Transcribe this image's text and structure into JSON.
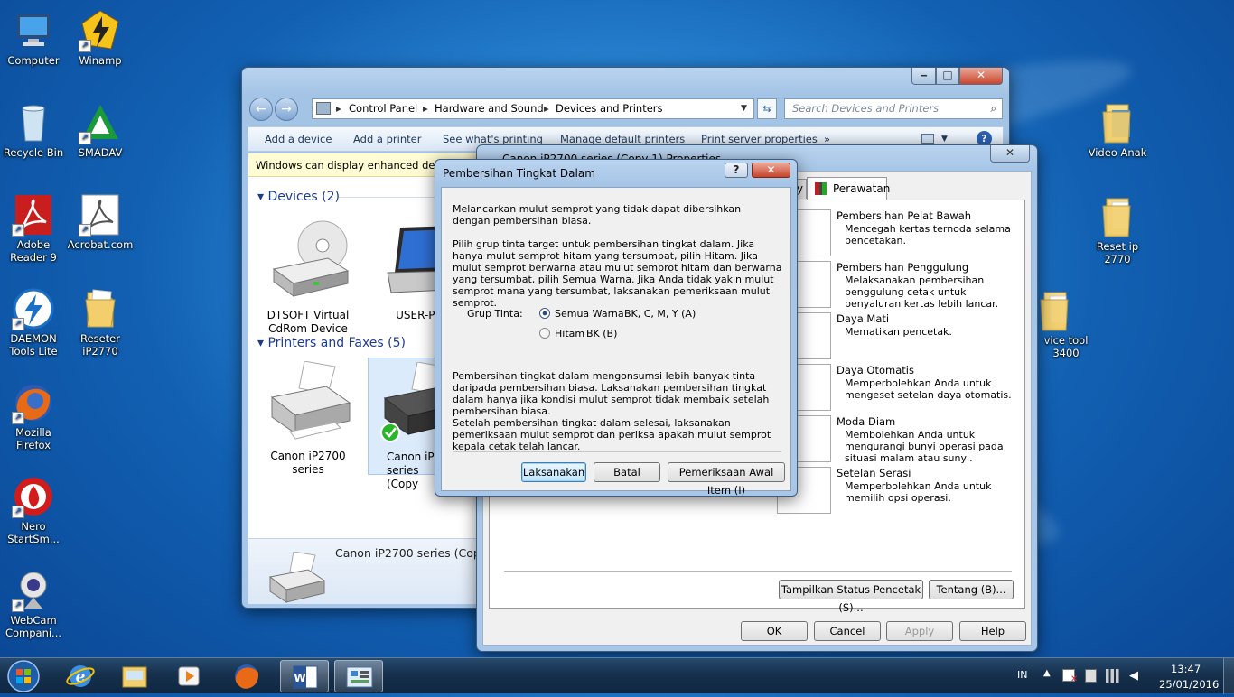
{
  "desktop_icons": [
    {
      "label": "Computer"
    },
    {
      "label": "Winamp"
    },
    {
      "label": "Recycle Bin"
    },
    {
      "label": "SMADAV"
    },
    {
      "label": "Adobe Reader 9"
    },
    {
      "label": "Acrobat.com"
    },
    {
      "label": "DAEMON Tools Lite"
    },
    {
      "label": "Reseter iP2770"
    },
    {
      "label": "Mozilla Firefox"
    },
    {
      "label": "Nero StartSm..."
    },
    {
      "label": "WebCam Compani..."
    },
    {
      "label": "Video Anak"
    },
    {
      "label": "Reset ip 2770"
    },
    {
      "label": "vice tool 3400"
    }
  ],
  "explorer": {
    "breadcrumb": [
      "Control Panel",
      "Hardware and Sound",
      "Devices and Printers"
    ],
    "search_placeholder": "Search Devices and Printers",
    "toolbar": [
      "Add a device",
      "Add a printer",
      "See what's printing",
      "Manage default printers",
      "Print server properties",
      "»"
    ],
    "infobar": "Windows can display enhanced device",
    "devices_header": "Devices (2)",
    "devices": [
      "DTSOFT Virtual CdRom Device",
      "USER-PC"
    ],
    "printers_header": "Printers and Faxes (5)",
    "printers": [
      "Canon iP2700 series",
      "Canon iP27 series (Copy"
    ],
    "details_name": "Canon iP2700 series (Copy"
  },
  "properties": {
    "title": "Canon iP2700 series (Copy 1) Properties",
    "tab_partial": "y",
    "tab_active": "Perawatan",
    "items": [
      {
        "title": "Pembersihan Pelat Bawah",
        "desc": "Mencegah kertas ternoda selama pencetakan."
      },
      {
        "title": "Pembersihan Penggulung",
        "desc": "Melaksanakan pembersihan penggulung cetak untuk penyaluran kertas lebih lancar."
      },
      {
        "title": "Daya Mati",
        "desc": "Mematikan pencetak."
      },
      {
        "title": "Daya Otomatis",
        "desc": "Memperbolehkan Anda untuk mengeset setelan daya otomatis."
      },
      {
        "title": "Moda Diam",
        "desc": "Membolehkan Anda untuk mengurangi bunyi operasi pada situasi malam atau sunyi."
      },
      {
        "title": "Setelan Serasi",
        "desc": "Memperbolehkan Anda untuk memilih opsi operasi."
      }
    ],
    "status_button": "Tampilkan Status Pencetak (S)...",
    "about_button": "Tentang (B)...",
    "ok": "OK",
    "cancel": "Cancel",
    "apply": "Apply",
    "help": "Help"
  },
  "dialog": {
    "title": "Pembersihan Tingkat Dalam",
    "para1": "Melancarkan mulut semprot yang tidak dapat dibersihkan dengan pembersihan biasa.",
    "para2": "Pilih grup tinta target untuk pembersihan tingkat dalam. Jika hanya mulut semprot hitam yang tersumbat, pilih Hitam. Jika mulut semprot berwarna atau mulut semprot hitam dan berwarna yang tersumbat, pilih Semua Warna. Jika Anda tidak yakin mulut semprot mana yang tersumbat, laksanakan pemeriksaan mulut semprot.",
    "group_label": "Grup Tinta:",
    "option1_name": "Semua Warna",
    "option1_inks": "BK, C, M, Y (A)",
    "option2_name": "Hitam",
    "option2_inks": "BK (B)",
    "selected_option": "Semua Warna",
    "para3": "Pembersihan tingkat dalam mengonsumsi lebih banyak tinta daripada pembersihan biasa. Laksanakan pembersihan tingkat dalam hanya jika kondisi mulut semprot tidak membaik setelah pembersihan biasa.",
    "para4": "Setelah pembersihan tingkat dalam selesai, laksanakan pemeriksaan mulut semprot dan periksa apakah mulut semprot kepala cetak telah lancar.",
    "btn_execute": "Laksanakan",
    "btn_cancel": "Batal",
    "btn_check": "Pemeriksaan Awal Item (I)"
  },
  "taskbar": {
    "lang": "IN",
    "time": "13:47",
    "date": "25/01/2016"
  },
  "colors": {
    "accent_blue": "#1e5fa8",
    "selection": "#dcebfc"
  }
}
